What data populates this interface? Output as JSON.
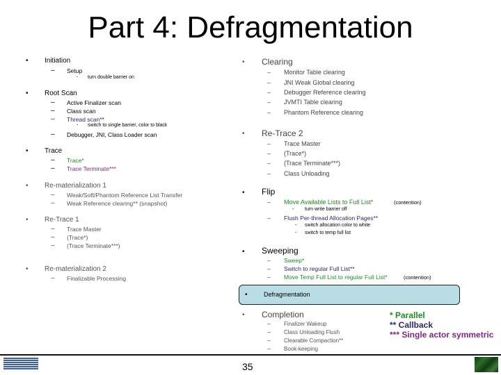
{
  "title": "Part 4: Defragmentation",
  "left_column": {
    "initiation": {
      "label": "Initiation",
      "sub": [
        "Setup"
      ],
      "subsub": [
        "turn double barrier on"
      ]
    },
    "root_scan": {
      "label": "Root Scan",
      "items": [
        "Active Finalizer scan",
        "Class scan",
        "Thread scan**",
        "Debugger, JNI, Class Loader scan"
      ],
      "thread_sub": "switch to single barrier, color to black"
    },
    "trace": {
      "label": "Trace",
      "items": [
        "Trace*",
        "Trace Terminate***"
      ]
    },
    "remat1": {
      "label": "Re-materialization 1",
      "items": [
        "Weak/Soft/Phantom Reference List Transfer",
        "Weak Reference clearing** (snapshot)"
      ]
    },
    "retrace1": {
      "label": "Re-Trace 1",
      "items": [
        "Trace Master",
        "(Trace*)",
        "(Trace Terminate***)"
      ]
    },
    "remat2": {
      "label": "Re-materialization 2",
      "items": [
        "Finalizable Processing"
      ]
    }
  },
  "right_column": {
    "clearing": {
      "label": "Clearing",
      "items": [
        "Monitor Table clearing",
        "JNI Weak Global clearing",
        "Debugger Reference clearing",
        "JVMTI Table clearing",
        "Phantom Reference clearing"
      ]
    },
    "retrace2": {
      "label": "Re-Trace 2",
      "items": [
        "Trace Master",
        "(Trace*)",
        "(Trace Terminate***)",
        "Class Unloading"
      ]
    },
    "flip": {
      "label": "Flip",
      "item1": "Move Available Lists to Full List*",
      "item1_suffix": "(contention)",
      "item1_sub": "turn write barrier off",
      "item2": "Flush Per-thread Allocation Pages**",
      "item2_sub": [
        "switch allocation color to white",
        "switch to temp full list"
      ]
    },
    "sweeping": {
      "label": "Sweeping",
      "items": [
        "Sweep*",
        "Switch to regular Full List**",
        "Move Temp Full List to regular Full List*"
      ],
      "item3_suffix": "(contention)"
    },
    "defragmentation": {
      "label": "Defragmentation"
    },
    "completion": {
      "label": "Completion",
      "items": [
        "Finalizer Wakeup",
        "Class Unloading Flush",
        "Clearable Compaction**",
        "Book-keeping"
      ]
    }
  },
  "legend": {
    "parallel": "* Parallel",
    "callback": "** Callback",
    "single": "*** Single actor symmetric"
  },
  "glyphs": {
    "bullet": "•",
    "dash": "–",
    "small_dash": "-"
  },
  "colors": {
    "parallel": "#1f8a2a",
    "callback": "#2b2a6b",
    "single": "#7a2a82",
    "defrag_box": "#b9dde2"
  },
  "footer": {
    "page_number": "35",
    "logo": "IBM"
  }
}
